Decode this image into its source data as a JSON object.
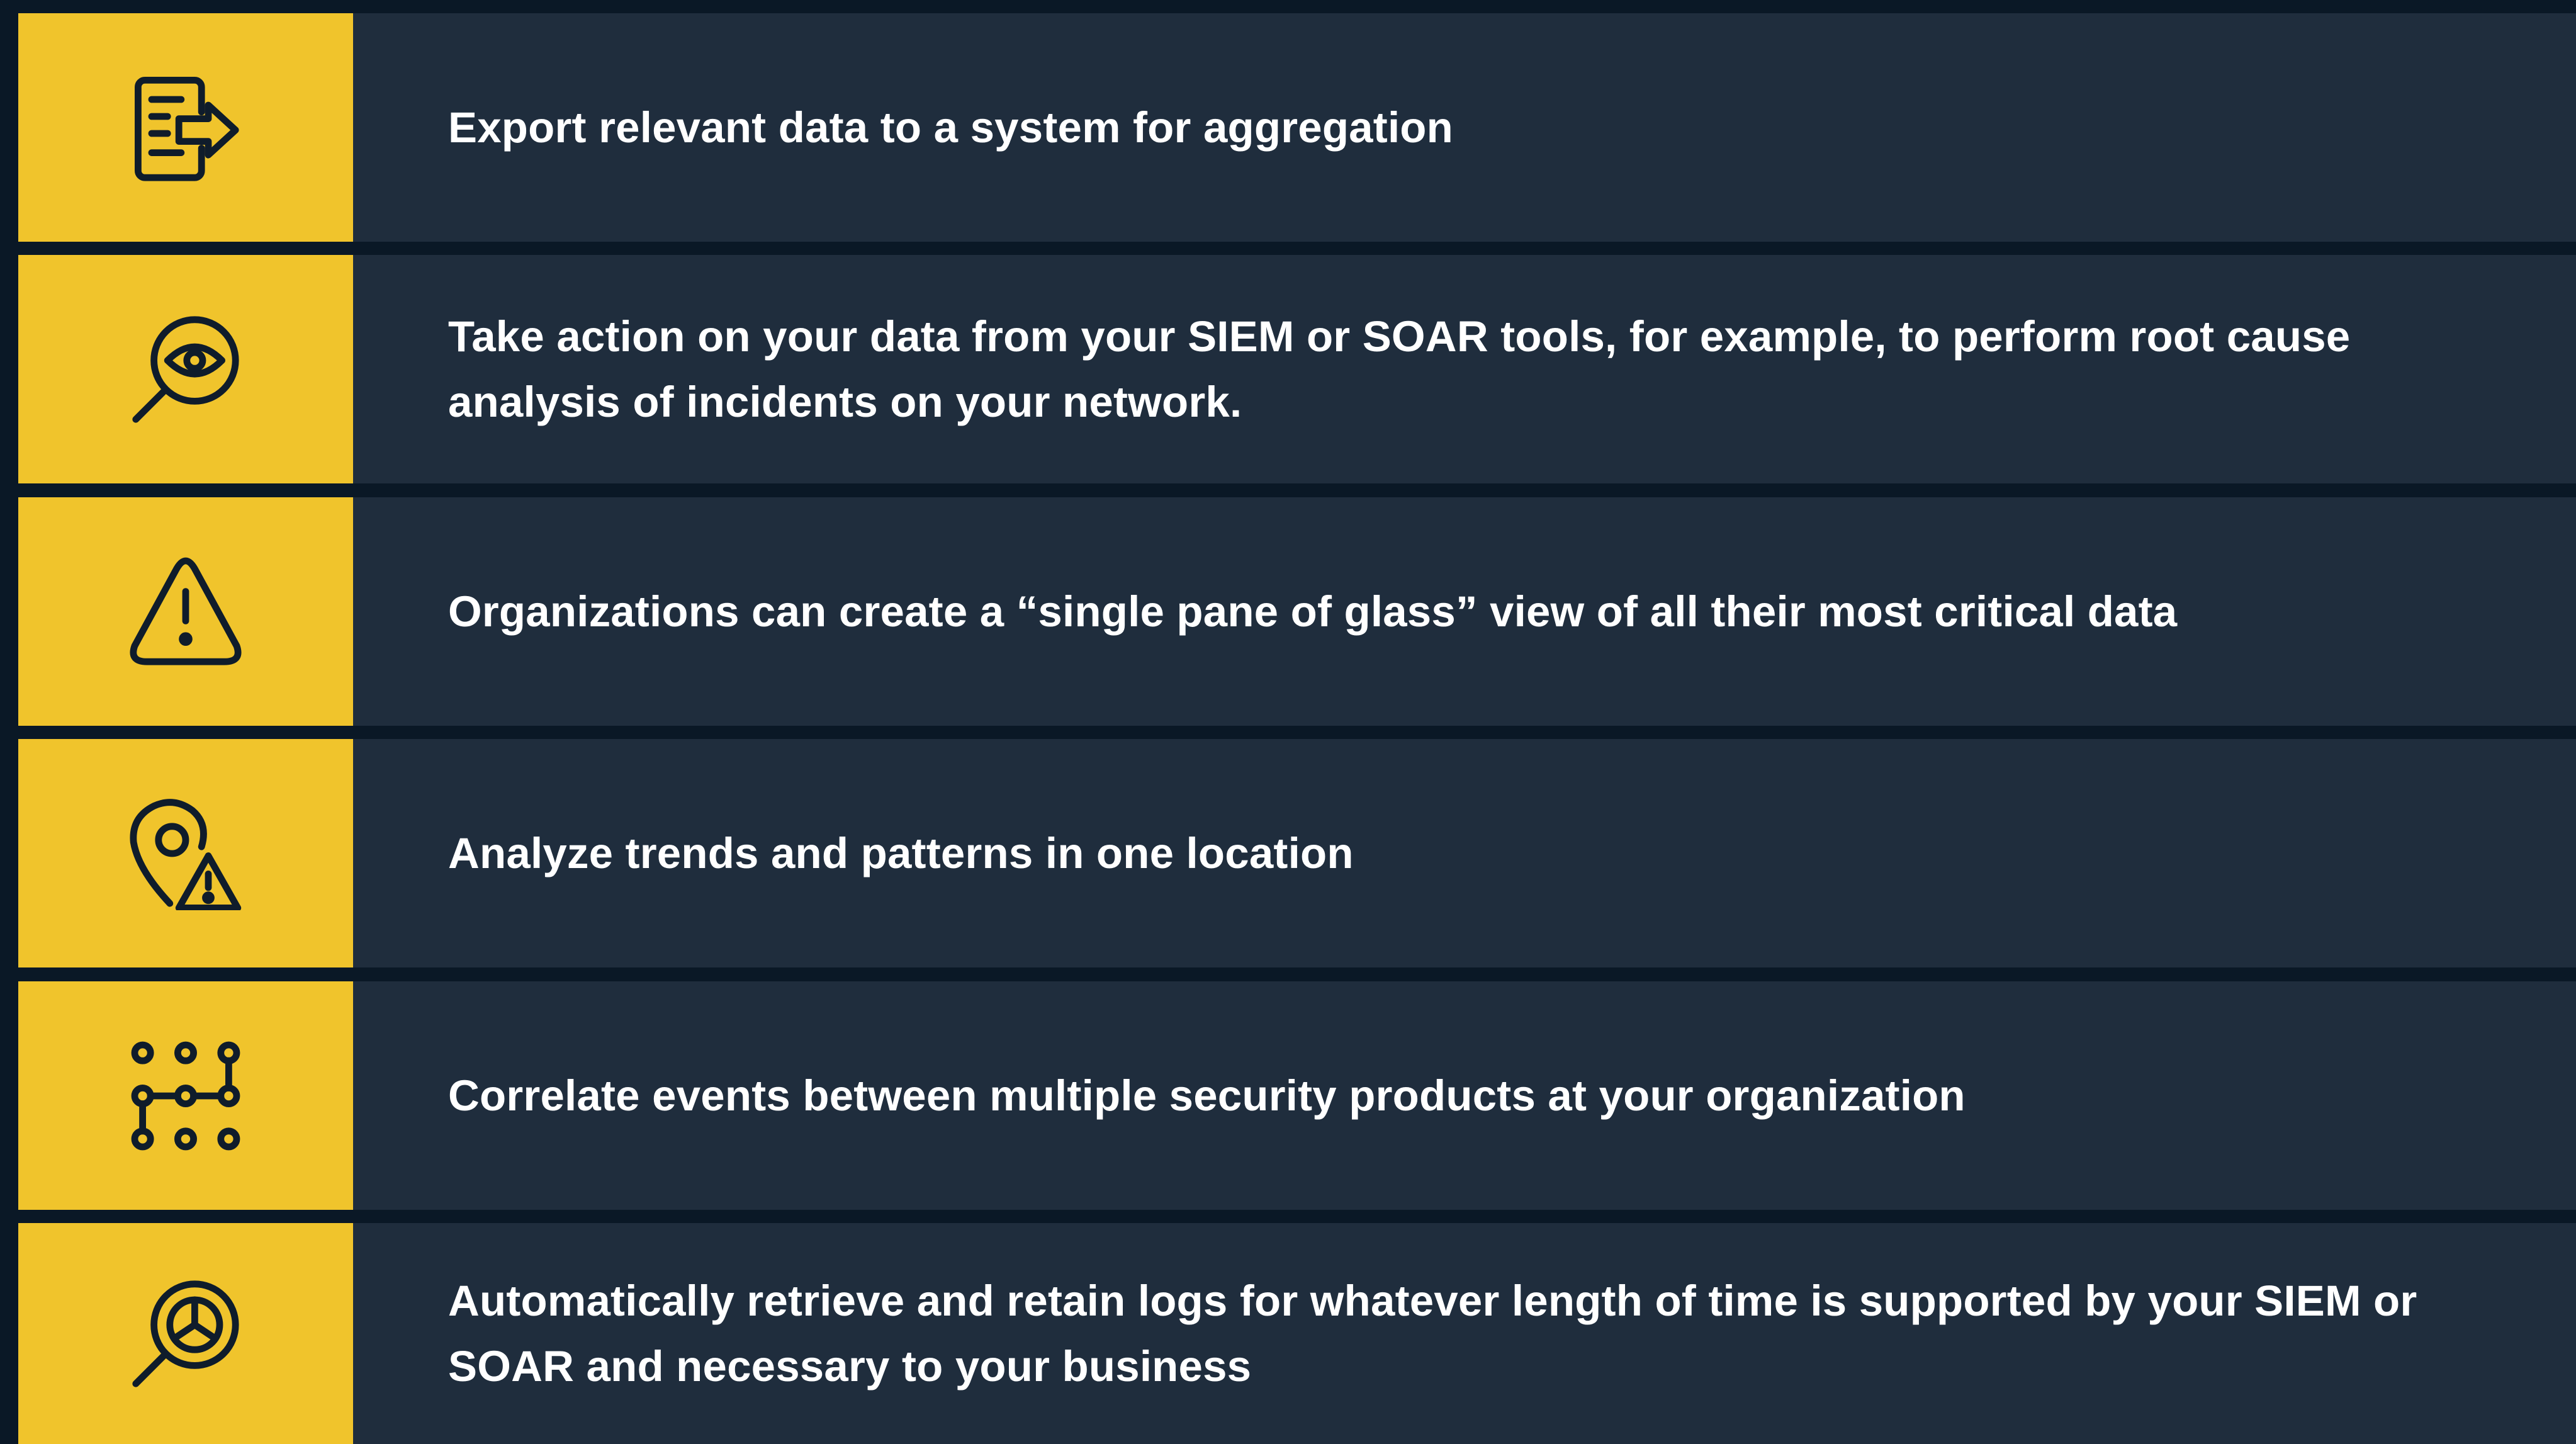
{
  "colors": {
    "background": "#0a1826",
    "row_background": "#1f2d3d",
    "icon_background": "#f0c42c",
    "icon_stroke": "#0f1c2b",
    "text": "#ffffff"
  },
  "items": [
    {
      "icon": "document-export-icon",
      "text": "Export relevant data to a system for aggregation"
    },
    {
      "icon": "magnifier-eye-icon",
      "text": "Take action on your data from your SIEM or SOAR tools, for example, to perform root cause analysis of incidents on your network."
    },
    {
      "icon": "warning-triangle-icon",
      "text": "Organizations can create a “single pane of glass” view of all their most critical data"
    },
    {
      "icon": "location-pin-warning-icon",
      "text": "Analyze trends and patterns in one location"
    },
    {
      "icon": "connected-dots-grid-icon",
      "text": "Correlate events between multiple security products at your organization"
    },
    {
      "icon": "magnifier-chart-icon",
      "text": "Automatically retrieve and retain logs for whatever length of time is supported by your SIEM or SOAR and necessary to your business"
    }
  ]
}
